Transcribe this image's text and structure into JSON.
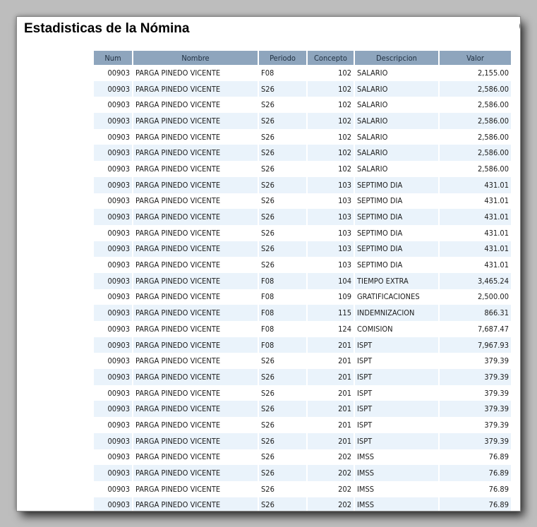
{
  "page": {
    "title": "Estadisticas de la Nómina",
    "edge_glyph": "("
  },
  "table": {
    "columns": [
      "Num",
      "Nombre",
      "Periodo",
      "Concepto",
      "Descripcion",
      "Valor"
    ],
    "rows": [
      [
        "00903",
        "PARGA PINEDO VICENTE",
        "F08",
        "102",
        "SALARIO",
        "2,155.00"
      ],
      [
        "00903",
        "PARGA PINEDO VICENTE",
        "S26",
        "102",
        "SALARIO",
        "2,586.00"
      ],
      [
        "00903",
        "PARGA PINEDO VICENTE",
        "S26",
        "102",
        "SALARIO",
        "2,586.00"
      ],
      [
        "00903",
        "PARGA PINEDO VICENTE",
        "S26",
        "102",
        "SALARIO",
        "2,586.00"
      ],
      [
        "00903",
        "PARGA PINEDO VICENTE",
        "S26",
        "102",
        "SALARIO",
        "2,586.00"
      ],
      [
        "00903",
        "PARGA PINEDO VICENTE",
        "S26",
        "102",
        "SALARIO",
        "2,586.00"
      ],
      [
        "00903",
        "PARGA PINEDO VICENTE",
        "S26",
        "102",
        "SALARIO",
        "2,586.00"
      ],
      [
        "00903",
        "PARGA PINEDO VICENTE",
        "S26",
        "103",
        "SEPTIMO DIA",
        "431.01"
      ],
      [
        "00903",
        "PARGA PINEDO VICENTE",
        "S26",
        "103",
        "SEPTIMO DIA",
        "431.01"
      ],
      [
        "00903",
        "PARGA PINEDO VICENTE",
        "S26",
        "103",
        "SEPTIMO DIA",
        "431.01"
      ],
      [
        "00903",
        "PARGA PINEDO VICENTE",
        "S26",
        "103",
        "SEPTIMO DIA",
        "431.01"
      ],
      [
        "00903",
        "PARGA PINEDO VICENTE",
        "S26",
        "103",
        "SEPTIMO DIA",
        "431.01"
      ],
      [
        "00903",
        "PARGA PINEDO VICENTE",
        "S26",
        "103",
        "SEPTIMO DIA",
        "431.01"
      ],
      [
        "00903",
        "PARGA PINEDO VICENTE",
        "F08",
        "104",
        "TIEMPO EXTRA",
        "3,465.24"
      ],
      [
        "00903",
        "PARGA PINEDO VICENTE",
        "F08",
        "109",
        "GRATIFICACIONES",
        "2,500.00"
      ],
      [
        "00903",
        "PARGA PINEDO VICENTE",
        "F08",
        "115",
        "INDEMNIZACION",
        "866.31"
      ],
      [
        "00903",
        "PARGA PINEDO VICENTE",
        "F08",
        "124",
        "COMISION",
        "7,687.47"
      ],
      [
        "00903",
        "PARGA PINEDO VICENTE",
        "F08",
        "201",
        "ISPT",
        "7,967.93"
      ],
      [
        "00903",
        "PARGA PINEDO VICENTE",
        "S26",
        "201",
        "ISPT",
        "379.39"
      ],
      [
        "00903",
        "PARGA PINEDO VICENTE",
        "S26",
        "201",
        "ISPT",
        "379.39"
      ],
      [
        "00903",
        "PARGA PINEDO VICENTE",
        "S26",
        "201",
        "ISPT",
        "379.39"
      ],
      [
        "00903",
        "PARGA PINEDO VICENTE",
        "S26",
        "201",
        "ISPT",
        "379.39"
      ],
      [
        "00903",
        "PARGA PINEDO VICENTE",
        "S26",
        "201",
        "ISPT",
        "379.39"
      ],
      [
        "00903",
        "PARGA PINEDO VICENTE",
        "S26",
        "201",
        "ISPT",
        "379.39"
      ],
      [
        "00903",
        "PARGA PINEDO VICENTE",
        "S26",
        "202",
        "IMSS",
        "76.89"
      ],
      [
        "00903",
        "PARGA PINEDO VICENTE",
        "S26",
        "202",
        "IMSS",
        "76.89"
      ],
      [
        "00903",
        "PARGA PINEDO VICENTE",
        "S26",
        "202",
        "IMSS",
        "76.89"
      ],
      [
        "00903",
        "PARGA PINEDO VICENTE",
        "S26",
        "202",
        "IMSS",
        "76.89"
      ]
    ]
  },
  "colors": {
    "header_bg": "#8ea5bd",
    "row_alt_bg": "#eaf3fb"
  }
}
